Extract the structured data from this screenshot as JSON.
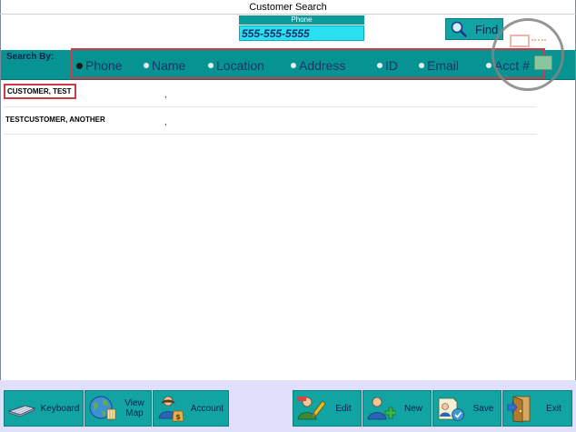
{
  "window": {
    "title": "Customer Search"
  },
  "phone": {
    "label": "Phone",
    "value": "555-555-5555"
  },
  "find_button": {
    "label": "Find"
  },
  "search_by": {
    "label": "Search By:",
    "options": [
      {
        "label": "Phone",
        "selected": true
      },
      {
        "label": "Name",
        "selected": false
      },
      {
        "label": "Location",
        "selected": false
      },
      {
        "label": "Address",
        "selected": false
      },
      {
        "label": "ID",
        "selected": false
      },
      {
        "label": "Email",
        "selected": false
      },
      {
        "label": "Acct #",
        "selected": false
      }
    ]
  },
  "results": [
    {
      "name": "CUSTOMER, TEST",
      "location": ","
    },
    {
      "name": "TESTCUSTOMER, ANOTHER",
      "location": ","
    }
  ],
  "toolbar": {
    "keyboard": "Keyboard",
    "view_map_1": "View",
    "view_map_2": "Map",
    "account": "Account",
    "edit": "Edit",
    "new": "New",
    "save": "Save",
    "exit": "Exit"
  },
  "colors": {
    "teal": "#089393",
    "button": "#12a3a3",
    "input": "#29e0f0",
    "highlight": "#d03a44",
    "toolbar_bg": "#e1e0fb"
  }
}
